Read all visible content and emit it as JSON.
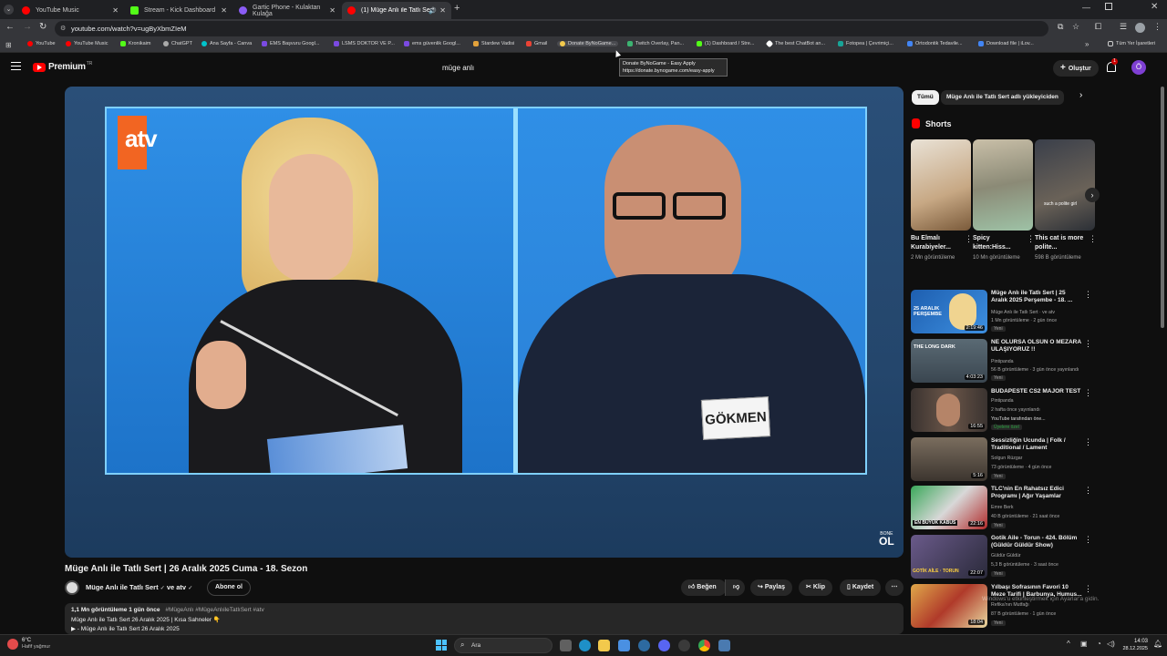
{
  "browser": {
    "tabs": [
      {
        "label": "YouTube Music",
        "color": "#ff0000"
      },
      {
        "label": "Stream - Kick Dashboard",
        "color": "#53fc18"
      },
      {
        "label": "Gartic Phone - Kulaktan Kulağa",
        "color": "#8b5cf6"
      },
      {
        "label": "(1) Müge Anlı ile Tatlı Sert |",
        "color": "#ff0000"
      }
    ],
    "url": "youtube.com/watch?v=ugByXbmZIeM",
    "bookmarks": [
      {
        "label": "YouTube",
        "color": "#ff0000"
      },
      {
        "label": "YouTube Music",
        "color": "#ff0000"
      },
      {
        "label": "Kronikaim",
        "color": "#53fc18"
      },
      {
        "label": "ChatGPT",
        "color": "#aaaaaa"
      },
      {
        "label": "Ana Sayfa - Canva",
        "color": "#00c4cc"
      },
      {
        "label": "EMS Başvuru Googl...",
        "color": "#7b4ae2"
      },
      {
        "label": "LSMS DOKTOR VE P...",
        "color": "#7b4ae2"
      },
      {
        "label": "ems güvenlik Googl...",
        "color": "#7b4ae2"
      },
      {
        "label": "Stardew Vadisi",
        "color": "#e3a23b"
      },
      {
        "label": "Gmail",
        "color": "#ea4335"
      },
      {
        "label": "Donate ByNoGame...",
        "color": "#f2c94c"
      },
      {
        "label": "Twitch Overlay, Pan...",
        "color": "#3cb371"
      },
      {
        "label": "(1) Dashboard / Stre...",
        "color": "#53fc18"
      },
      {
        "label": "The best ChatBot an...",
        "color": "#ffffff"
      },
      {
        "label": "Fotopea | Çevrimiçi...",
        "color": "#18a497"
      },
      {
        "label": "Ortodontik Tedavile...",
        "color": "#4285f4"
      },
      {
        "label": "Download file | iLov...",
        "color": "#4285f4"
      }
    ],
    "all_bookmarks": "Tüm Yer İşaretleri",
    "tooltip_title": "Donate ByNoGame - Easy Apply",
    "tooltip_url": "https://donate.bynogame.com/easy-apply"
  },
  "header": {
    "logo": "Premium",
    "logo_sup": "TR",
    "search_value": "müge anlı",
    "create_label": "Oluştur",
    "notif_count": "1",
    "avatar_letter": "Ö"
  },
  "player": {
    "channel_logo": "atv",
    "name_tag": "GÖKMEN",
    "corner_text": "BONE",
    "corner_logo": "OL"
  },
  "video": {
    "title": "Müge Anlı ile Tatlı Sert | 26 Aralık 2025 Cuma - 18. Sezon",
    "channel": "Müge Anlı ile Tatlı Sert",
    "channel_suffix": "ve atv",
    "subscribe": "Abone ol",
    "like": "Beğen",
    "share": "Paylaş",
    "clip": "Klip",
    "save": "Kaydet",
    "views_line": "1,1 Mn görüntüleme  1 gün önce",
    "hashtags": "#MügeAnlı #MügeAnlıileTatlıSert #atv",
    "desc_line1": "Müge Anlı ile Tatlı Sert 26 Aralık 2025 | Kısa Sahneler 👇",
    "desc_line2": "▶ - Müge Anlı ile Tatlı Sert 26 Aralık 2025"
  },
  "sidebar": {
    "chips": [
      "Tümü",
      "Müge Anlı ile Tatlı Sert adlı yükleyiciden"
    ],
    "shorts_title": "Shorts",
    "shorts": [
      {
        "title": "Bu Elmalı Kurabiyeler...",
        "views": "2 Mn görüntüleme"
      },
      {
        "title": "Spicy kitten:Hiss...",
        "views": "10 Mn görüntüleme"
      },
      {
        "title": "This cat is more polite...",
        "views": "598 B görüntüleme"
      }
    ],
    "short3_overlay": "such a polite girl",
    "videos": [
      {
        "title": "Müge Anlı ile Tatlı Sert | 25 Aralık 2025 Perşembe - 18. ...",
        "channel": "Müge Anlı ile Tatlı Sert · ve atv",
        "meta": "1 Mn görüntüleme · 2 gün önce",
        "badge": "Yeni",
        "duration": "2:19:46",
        "thumb_text": "25 ARALIK PERŞEMBE",
        "thumb_color": "#1e5fb0"
      },
      {
        "title": "NE OLURSA OLSUN O MEZARA ULAŞIYORUZ !!",
        "channel": "Pintipanda",
        "meta": "56 B görüntüleme · 3 gün önce yayınlandı",
        "badge": "Yeni",
        "duration": "4:03:23",
        "thumb_text": "THE LONG DARK",
        "thumb_color": "#4a5a66"
      },
      {
        "title": "BUDAPESTE CS2 MAJOR TEST",
        "channel": "Pintipanda",
        "meta": "2 hafta önce yayınlandı",
        "badge": "YouTube tarafından öne...",
        "members": "Üyelere özel",
        "duration": "16:55",
        "thumb_text": "",
        "thumb_color": "#3a3330"
      },
      {
        "title": "Sessizliğin Ucunda | Folk / Traditional / Lament",
        "channel": "Solgun Rüzgar",
        "meta": "73 görüntüleme · 4 gün önce",
        "badge": "Yeni",
        "duration": "5:16",
        "thumb_text": "",
        "thumb_color": "#5a5048"
      },
      {
        "title": "TLC'nin En Rahatsız Edici Programı | Ağır Yaşamlar",
        "channel": "Emre Berk",
        "meta": "40 B görüntüleme · 21 saat önce",
        "badge": "Yeni",
        "duration": "22:16",
        "thumb_text": "EN BÜYÜK KABUS",
        "thumb_color": "#b02a2a"
      },
      {
        "title": "Gotik Aile - Torun - 424. Bölüm (Güldür Güldür Show)",
        "channel": "Güldür Güldür",
        "meta": "5,3 B görüntüleme · 3 saat önce",
        "badge": "Yeni",
        "duration": "22:07",
        "thumb_text": "GOTİK AİLE · TORUN",
        "thumb_color": "#4a3a6a"
      },
      {
        "title": "Yılbaşı Sofrasının Favori 10 Meze Tarifi | Barbunya, Humus...",
        "channel": "Refika'nın Mutfağı",
        "meta": "87 B görüntüleme · 1 gün önce",
        "badge": "Yeni",
        "duration": "18:04",
        "thumb_text": "",
        "thumb_color": "#c98a3a"
      }
    ]
  },
  "activation": "Windows'u etkinleştirmek için Ayarlar'a gidin.",
  "taskbar": {
    "weather_temp": "6°C",
    "weather_desc": "Hafif yağmur",
    "search": "Ara",
    "time": "14:03",
    "date": "28.12.2025"
  }
}
